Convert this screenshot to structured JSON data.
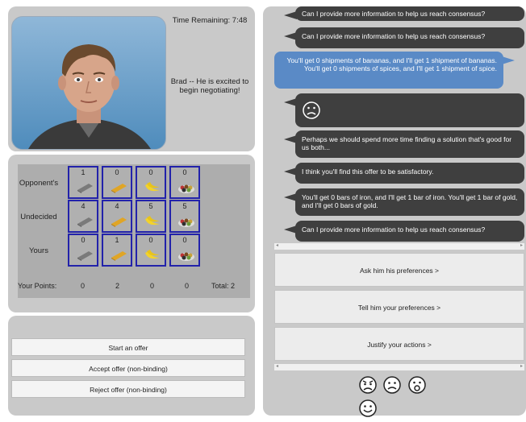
{
  "avatar": {
    "time_remaining": "Time Remaining: 7:48",
    "agent_status": "Brad -- He is excited to begin negotiating!"
  },
  "grid": {
    "rows": [
      {
        "label": "Opponent's",
        "values": [
          "1",
          "0",
          "0",
          "0"
        ]
      },
      {
        "label": "Undecided",
        "values": [
          "4",
          "4",
          "5",
          "5"
        ]
      },
      {
        "label": "Yours",
        "values": [
          "0",
          "1",
          "0",
          "0"
        ]
      }
    ],
    "items": [
      "iron-icon",
      "gold-icon",
      "bananas-icon",
      "spices-icon"
    ],
    "points_label": "Your Points:",
    "points": [
      "0",
      "2",
      "0",
      "0"
    ],
    "total": "Total: 2"
  },
  "actions": {
    "start_offer": "Start an offer",
    "accept_offer": "Accept offer (non-binding)",
    "reject_offer": "Reject offer (non-binding)"
  },
  "chat": {
    "messages": [
      {
        "role": "agent",
        "text": "Can I provide more information to help us reach consensus?"
      },
      {
        "role": "agent",
        "text": "Can I provide more information to help us reach consensus?"
      },
      {
        "role": "user",
        "text": "You'll get 0 shipments of bananas, and I'll get 1 shipment of bananas. You'll get 0 shipments of spices, and I'll get 1 shipment of spice."
      },
      {
        "role": "agent",
        "text": "sad-face-icon"
      },
      {
        "role": "agent",
        "text": "Perhaps we should spend more time finding a solution that's good for us both..."
      },
      {
        "role": "agent",
        "text": "I think you'll find this offer to be satisfactory."
      },
      {
        "role": "agent",
        "text": "You'll get 0 bars of iron, and I'll get 1 bar of iron. You'll get 1 bar of gold, and I'll get 0 bars of gold."
      },
      {
        "role": "agent",
        "text": "Can I provide more information to help us reach consensus?"
      }
    ],
    "buttons": {
      "ask_preferences": "Ask him his preferences >",
      "tell_preferences": "Tell him your preferences >",
      "justify_actions": "Justify your actions >"
    },
    "emojis": [
      "angry-face-icon",
      "sad-face-icon",
      "surprised-face-icon",
      "happy-face-icon"
    ],
    "colors": {
      "agent_bubble": "#3f3f3f",
      "user_bubble": "#5a8ac6"
    }
  }
}
